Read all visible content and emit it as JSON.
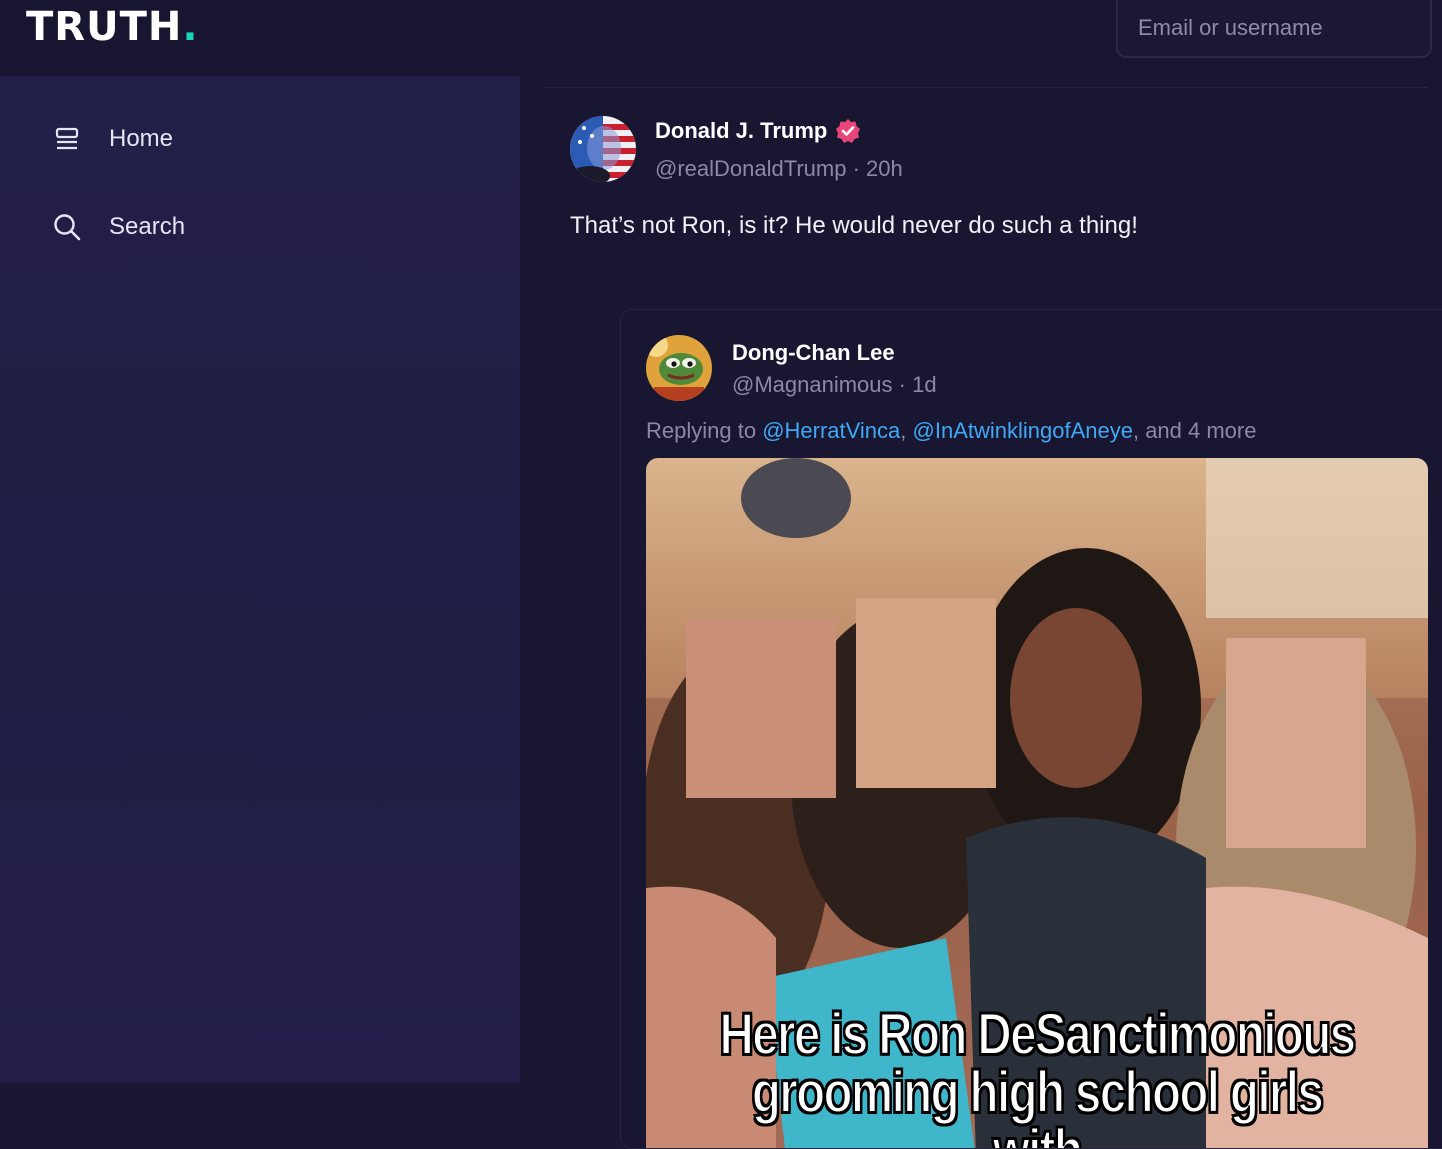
{
  "brand": {
    "logo_text": "TRUTH",
    "logo_dot": ".",
    "accent_color": "#1bd4b6"
  },
  "header": {
    "login_placeholder": "Email or username"
  },
  "sidebar": {
    "items": [
      {
        "label": "Home",
        "icon": "home-stack-icon"
      },
      {
        "label": "Search",
        "icon": "search-icon"
      }
    ]
  },
  "post": {
    "author_name": "Donald J. Trump",
    "verified": true,
    "handle": "@realDonaldTrump",
    "time_sep": " · ",
    "time": "20h",
    "text": "That’s not Ron, is it? He would never do such a thing!",
    "quote": {
      "author_name": "Dong-Chan Lee",
      "handle": "@Magnanimous",
      "time_sep": " · ",
      "time": "1d",
      "reply_prefix": "Replying to ",
      "mention_1": "@HerratVinca",
      "comma": ", ",
      "mention_2": "@InAtwinklingofAneye",
      "reply_suffix": ", and 4 more",
      "image_caption_line1": "Here is Ron DeSanctimonious",
      "image_caption_line2": "grooming high school girls with"
    }
  },
  "colors": {
    "mention": "#3fa9f5",
    "verified_badge": "#e8457a"
  }
}
